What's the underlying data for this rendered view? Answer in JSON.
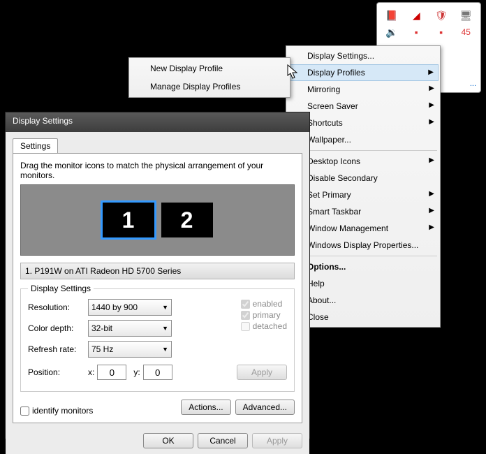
{
  "tray": {
    "count": "45",
    "customize": "..."
  },
  "context": {
    "display_settings": "Display Settings...",
    "display_profiles": "Display Profiles",
    "mirroring": "Mirroring",
    "screen_saver": "Screen Saver",
    "shortcuts": "Shortcuts",
    "wallpaper": "Wallpaper...",
    "desktop_icons": "Desktop Icons",
    "disable_secondary": "Disable Secondary",
    "set_primary": "Set Primary",
    "smart_taskbar": "Smart Taskbar",
    "window_mgmt": "Window Management",
    "win_disp_props": "Windows Display Properties...",
    "options": "Options...",
    "help": "Help",
    "about": "About...",
    "close": "Close"
  },
  "submenu": {
    "new_profile": "New Display Profile",
    "manage_profiles": "Manage Display Profiles"
  },
  "window": {
    "title": "Display Settings",
    "tab": "Settings",
    "instruction": "Drag the monitor icons to match the physical arrangement of your monitors.",
    "monitor1": "1",
    "monitor2": "2",
    "info": "1. P191W on ATI Radeon HD 5700 Series",
    "fs_title": "Display Settings",
    "resolution_lbl": "Resolution:",
    "resolution_val": "1440 by 900",
    "color_lbl": "Color depth:",
    "color_val": "32-bit",
    "refresh_lbl": "Refresh rate:",
    "refresh_val": "75 Hz",
    "enabled": "enabled",
    "primary": "primary",
    "detached": "detached",
    "position_lbl": "Position:",
    "x_lbl": "x:",
    "x_val": "0",
    "y_lbl": "y:",
    "y_val": "0",
    "apply_small": "Apply",
    "identify": "identify monitors",
    "actions": "Actions...",
    "advanced": "Advanced...",
    "ok": "OK",
    "cancel": "Cancel",
    "apply": "Apply"
  }
}
